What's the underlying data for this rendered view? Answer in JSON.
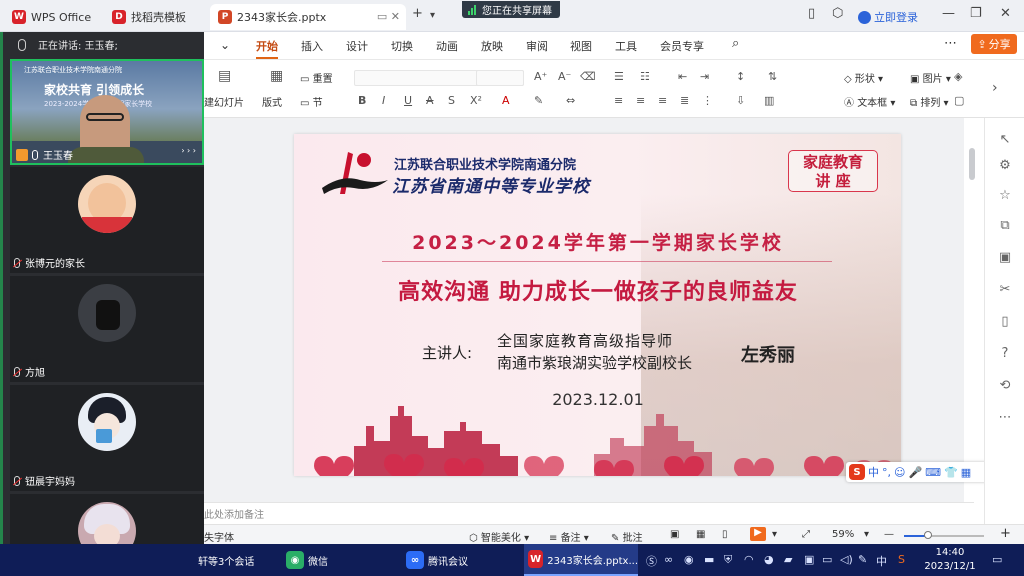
{
  "tabs": [
    {
      "label": "WPS Office",
      "color": "#d8232a",
      "icon": "wps-logo-icon"
    },
    {
      "label": "找稻壳模板",
      "color": "#d8232a",
      "icon": "docer-icon"
    },
    {
      "label": "2343家长会.pptx",
      "color": "#d24726",
      "icon": "ppt-file-icon"
    }
  ],
  "tab_new": "+",
  "share_banner": "您正在共享屏幕",
  "login": "立即登录",
  "window": {
    "minimize": "—",
    "restore": "❐",
    "close": "✕"
  },
  "meeting": {
    "speaking": "正在讲话:  王玉春;",
    "video_title": "家校共育 引领成长",
    "video_school": "江苏联合职业技术学院南通分院",
    "video_sub": "2023-2024学年第一学期家长学校",
    "more": "› › ›",
    "participants": [
      {
        "name": "王玉春",
        "video": true
      },
      {
        "name": "张博元的家长",
        "avatar_color": "#f6d5b8"
      },
      {
        "name": "方旭",
        "avatar_color": "#3b3e44"
      },
      {
        "name": "钮晨宇妈妈",
        "avatar_color": "#e9eef5"
      },
      {
        "name": "",
        "avatar_color": "#c9a9b0"
      }
    ]
  },
  "menu": {
    "items": [
      "开始",
      "插入",
      "设计",
      "切换",
      "动画",
      "放映",
      "审阅",
      "视图",
      "工具",
      "会员专享"
    ],
    "active": "开始",
    "share": "分享"
  },
  "toolbar": {
    "new_slide": "建幻灯片",
    "layout": "版式",
    "reset": "重置",
    "section": "节",
    "shape": "形状",
    "picture": "图片",
    "textbox": "文本框",
    "arrange": "排列"
  },
  "slide": {
    "school_name": "江苏联合职业技术学院南通分院",
    "school_name2": "江苏省南通中等专业学校",
    "lecture_l1": "家庭教育",
    "lecture_l2": "讲   座",
    "title": "2023～2024学年第一学期家长学校",
    "subtitle": "高效沟通  助力成长一做孩子的良师益友",
    "speaker_label": "主讲人:",
    "speaker_line1": "全国家庭教育高级指导师",
    "speaker_line2": "南通市紫琅湖实验学校副校长",
    "speaker_name": "左秀丽",
    "date": "2023.12.01"
  },
  "note_placeholder": "此处添加备注",
  "status": {
    "font_missing": "失字体",
    "smart": "智能美化",
    "notes": "备注",
    "comments": "批注",
    "zoom": "59%",
    "zoom_fraction": 0.3
  },
  "ime": {
    "logo": "S",
    "mode": "中"
  },
  "taskbar": {
    "items": [
      {
        "label": "轩等3个会话",
        "icon": "chat-icon",
        "color": "#2f6fe0"
      },
      {
        "label": "微信",
        "icon": "wechat-icon",
        "color": "#2aae67"
      },
      {
        "label": "腾讯会议",
        "icon": "tencent-meeting-icon",
        "color": "#2c6cf6"
      },
      {
        "label": "2343家长会.pptx...",
        "icon": "wps-task-icon",
        "color": "#d8232a"
      }
    ],
    "time": "14:40",
    "date": "2023/12/1",
    "lang": "中"
  }
}
